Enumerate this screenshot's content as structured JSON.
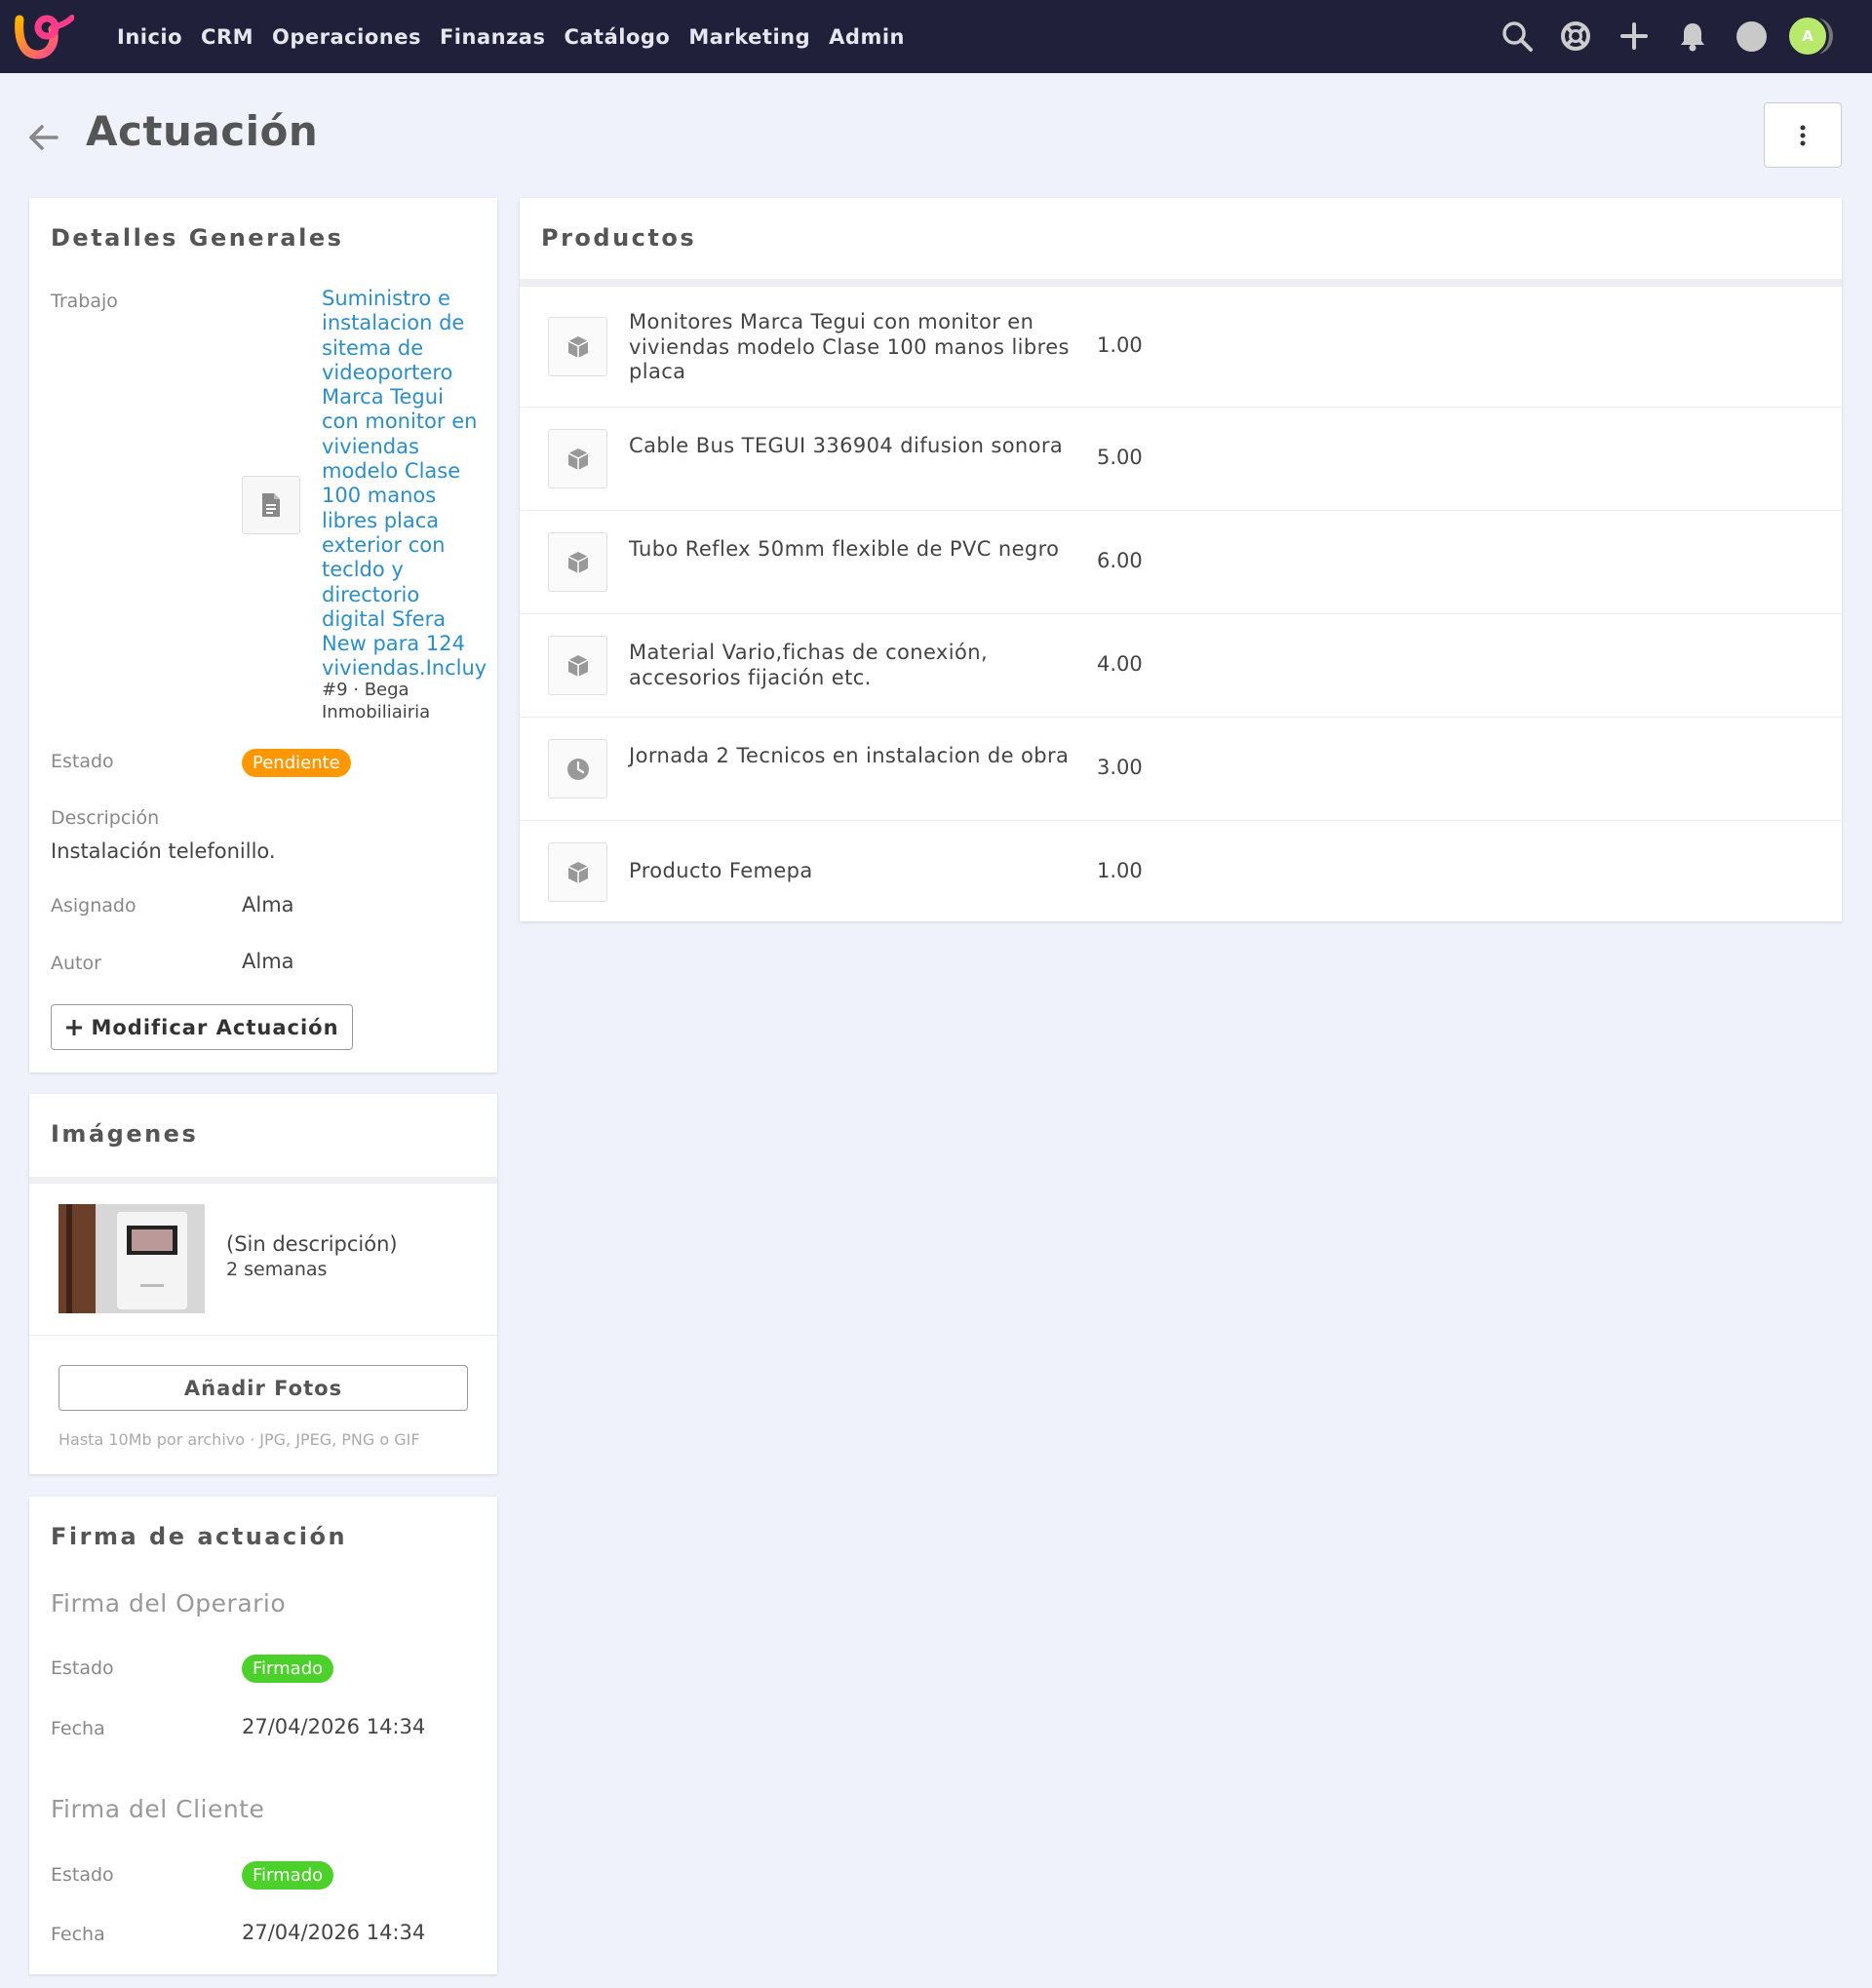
{
  "nav": {
    "items": [
      "Inicio",
      "CRM",
      "Operaciones",
      "Finanzas",
      "Catálogo",
      "Marketing",
      "Admin"
    ],
    "avatar_initial": "A"
  },
  "page": {
    "title": "Actuación"
  },
  "detalles": {
    "title": "Detalles Generales",
    "trabajo_label": "Trabajo",
    "trabajo_lines": [
      "Suministro e",
      "instalacion de",
      "sitema de",
      "videoportero",
      "Marca Tegui",
      "con monitor en",
      "viviendas",
      "modelo Clase",
      "100 manos",
      "libres placa",
      "exterior con",
      "tecldo y",
      "directorio",
      "digital Sfera",
      "New para 124",
      "viviendas.Incluy"
    ],
    "trabajo_meta": [
      "#9 · Bega",
      "Inmobiliairia"
    ],
    "estado_label": "Estado",
    "estado_value": "Pendiente",
    "descripcion_label": "Descripción",
    "descripcion_value": "Instalación telefonillo.",
    "asignado_label": "Asignado",
    "asignado_value": "Alma",
    "autor_label": "Autor",
    "autor_value": "Alma",
    "modify_button": "Modificar Actuación"
  },
  "imagenes": {
    "title": "Imágenes",
    "items": [
      {
        "description": "(Sin descripción)",
        "age": "2 semanas"
      }
    ],
    "add_button": "Añadir Fotos",
    "hint": "Hasta 10Mb por archivo · JPG, JPEG, PNG o GIF"
  },
  "firma": {
    "title": "Firma de actuación",
    "operario": {
      "heading": "Firma del Operario",
      "estado_label": "Estado",
      "estado_value": "Firmado",
      "fecha_label": "Fecha",
      "fecha_value": "27/04/2026 14:34"
    },
    "cliente": {
      "heading": "Firma del Cliente",
      "estado_label": "Estado",
      "estado_value": "Firmado",
      "fecha_label": "Fecha",
      "fecha_value": "27/04/2026 14:34"
    }
  },
  "productos": {
    "title": "Productos",
    "items": [
      {
        "name": "Monitores Marca Tegui con monitor en viviendas modelo Clase 100 manos libres placa",
        "qty": "1.00",
        "icon": "box-icon"
      },
      {
        "name": "Cable Bus TEGUI 336904 difusion sonora",
        "qty": "5.00",
        "icon": "box-icon"
      },
      {
        "name": "Tubo Reflex 50mm flexible de PVC negro",
        "qty": "6.00",
        "icon": "box-icon"
      },
      {
        "name": "Material Vario,fichas de conexión, accesorios fijación etc.",
        "qty": "4.00",
        "icon": "box-icon"
      },
      {
        "name": "Jornada 2 Tecnicos en instalacion de obra",
        "qty": "3.00",
        "icon": "clock-icon"
      },
      {
        "name": "Producto Femepa",
        "qty": "1.00",
        "icon": "box-icon"
      }
    ]
  },
  "colors": {
    "nav_bg": "#20203a",
    "link": "#2c8ec6",
    "pending": "#ff9800",
    "signed": "#4cd12a",
    "avatar": "#b8e86c"
  }
}
